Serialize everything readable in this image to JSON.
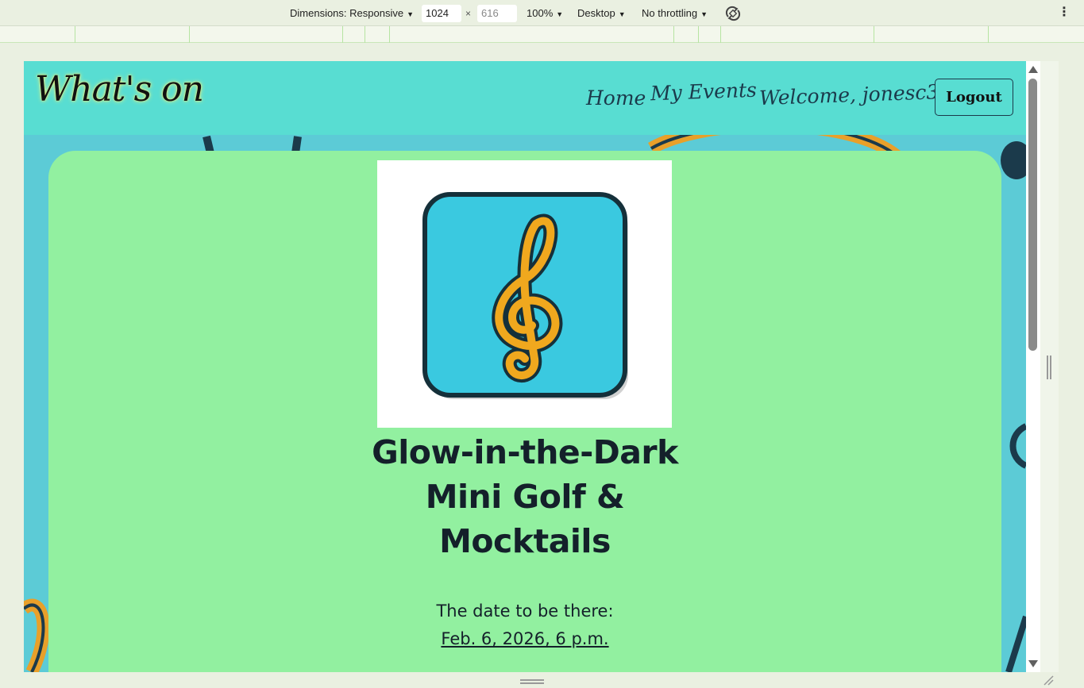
{
  "devtools": {
    "dimensions_label": "Dimensions: Responsive",
    "width_value": "1024",
    "height_value": "616",
    "zoom": "100%",
    "device": "Desktop",
    "throttling": "No throttling",
    "times_symbol": "×"
  },
  "site": {
    "brand": "What's on",
    "nav": {
      "home": "Home",
      "my_events": "My Events",
      "welcome": "Welcome, jonesc3!",
      "logout": "Logout"
    },
    "event": {
      "title_lines": [
        "Glow-in-the-Dark",
        "Mini Golf &",
        "Mocktails"
      ],
      "date_label": "The date to be there:",
      "date_value": "Feb. 6, 2026, 6 p.m."
    }
  },
  "colors": {
    "header_bg": "#58ddd2",
    "page_bg": "#5ccbd6",
    "card_bg": "#92f0a0",
    "icon_tile": "#3ac9e0",
    "treble_clef": "#f0a81e",
    "outline": "#15303a"
  },
  "icons": {
    "event_image": "treble-clef-icon",
    "rotate": "rotate-icon",
    "menu": "kebab-menu-icon"
  }
}
